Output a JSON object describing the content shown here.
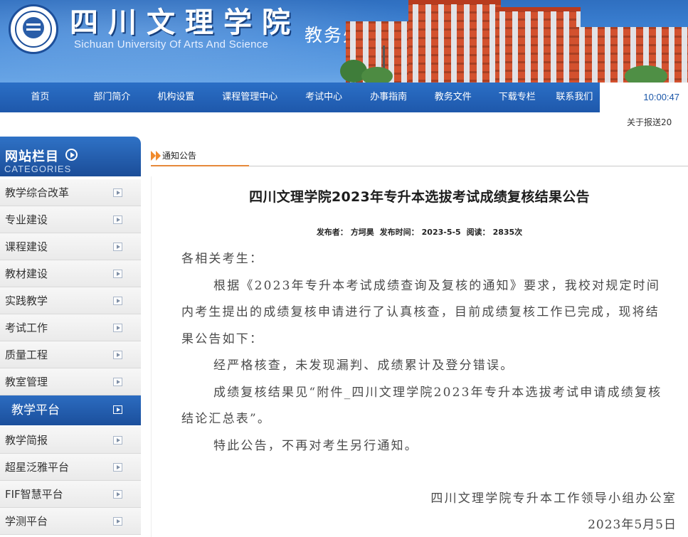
{
  "header": {
    "school_name_cn": "四川文理学院",
    "school_name_en": "Sichuan University Of Arts And Science",
    "department": "教务处",
    "logo_icon": "university-seal-icon"
  },
  "nav": {
    "items": [
      {
        "label": "首页"
      },
      {
        "label": "部门简介"
      },
      {
        "label": "机构设置"
      },
      {
        "label": "课程管理中心"
      },
      {
        "label": "考试中心"
      },
      {
        "label": "办事指南"
      },
      {
        "label": "教务文件"
      },
      {
        "label": "下载专栏"
      },
      {
        "label": "联系我们"
      }
    ],
    "clock": "10:00:47"
  },
  "marquee": {
    "text": "关于报送20"
  },
  "sidebar": {
    "title_cn": "网站栏目",
    "title_en": "CATEGORIES",
    "items": [
      {
        "label": "教学综合改革",
        "active": false
      },
      {
        "label": "专业建设",
        "active": false
      },
      {
        "label": "课程建设",
        "active": false
      },
      {
        "label": "教材建设",
        "active": false
      },
      {
        "label": "实践教学",
        "active": false
      },
      {
        "label": "考试工作",
        "active": false
      },
      {
        "label": "质量工程",
        "active": false
      },
      {
        "label": "教室管理",
        "active": false
      },
      {
        "label": "教学平台",
        "active": true
      },
      {
        "label": "教学简报",
        "active": false
      },
      {
        "label": "超星泛雅平台",
        "active": false
      },
      {
        "label": "FIF智慧平台",
        "active": false
      },
      {
        "label": "学测平台",
        "active": false
      }
    ]
  },
  "section": {
    "tab_label": "通知公告"
  },
  "article": {
    "title": "四川文理学院2023年专升本选拔考试成绩复核结果公告",
    "meta": {
      "publisher_label": "发布者：",
      "publisher": "方坷昊",
      "time_label": "发布时间：",
      "time": "2023-5-5",
      "reads_label": "阅读：",
      "reads": "2835次"
    },
    "paragraphs": [
      "各相关考生：",
      "根据《2023年专升本考试成绩查询及复核的通知》要求，我校对规定时间内考生提出的成绩复核申请进行了认真核查，目前成绩复核工作已完成，现将结果公告如下：",
      "经严格核查，未发现漏判、成绩累计及登分错误。",
      "成绩复核结果见“附件_四川文理学院2023年专升本选拔考试申请成绩复核结论汇总表”。",
      "特此公告，不再对考生另行通知。"
    ],
    "signature": "四川文理学院专升本工作领导小组办公室",
    "date": "2023年5月5日"
  },
  "colors": {
    "nav_blue": "#1e58ab",
    "accent_orange": "#f08a2c",
    "body_text": "#4a4a4a"
  }
}
